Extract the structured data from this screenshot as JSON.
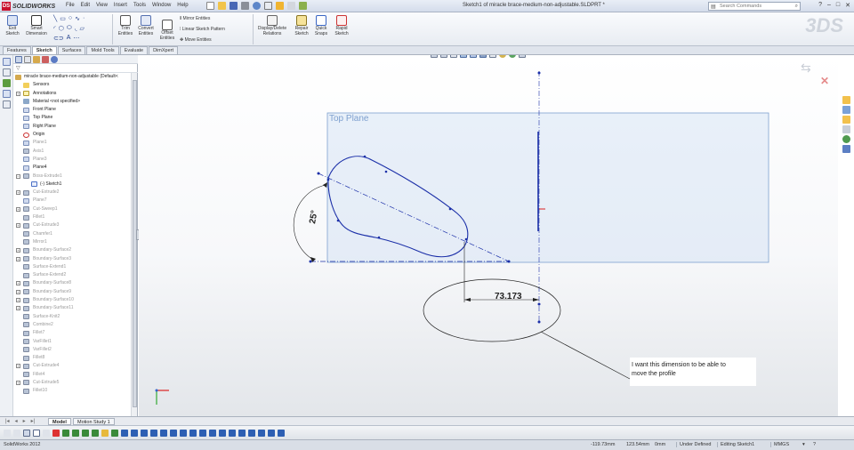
{
  "app": {
    "brand": "SOLIDWORKS",
    "logo_mark": "DS",
    "menus": [
      "File",
      "Edit",
      "View",
      "Insert",
      "Tools",
      "Window",
      "Help"
    ],
    "document_title": "Sketch1 of miracle brace-medium-non-adjustable.SLDPRT *",
    "search_placeholder": "Search Commands",
    "window_controls": [
      "?",
      "–",
      "□",
      "✕"
    ]
  },
  "command_manager": {
    "exit_sketch": "Exit Sketch",
    "smart_dimension": "Smart Dimension",
    "trim_entities": "Trim Entities",
    "convert_entities": "Convert Entities",
    "offset_entities": "Offset Entities",
    "mirror_entities": "Mirror Entities",
    "linear_sketch_pattern": "Linear Sketch Pattern",
    "move_entities": "Move Entities",
    "display_delete_relations": "Display/Delete Relations",
    "repair_sketch": "Repair Sketch",
    "quick_snaps": "Quick Snaps",
    "rapid_sketch": "Rapid Sketch",
    "watermark": "3DS"
  },
  "tabs": [
    "Features",
    "Sketch",
    "Surfaces",
    "Mold Tools",
    "Evaluate",
    "DimXpert"
  ],
  "active_tab": "Sketch",
  "feature_tree": [
    {
      "label": "miracle brace-medium-non-adjustable  (Default<",
      "icon": "part",
      "expand": "",
      "level": "root",
      "gray": false
    },
    {
      "label": "Sensors",
      "icon": "sensor",
      "expand": "",
      "level": "item",
      "gray": false
    },
    {
      "label": "Annotations",
      "icon": "ann",
      "expand": "+",
      "level": "item",
      "gray": false
    },
    {
      "label": "Material <not specified>",
      "icon": "mat",
      "expand": "",
      "level": "item",
      "gray": false
    },
    {
      "label": "Front Plane",
      "icon": "plane",
      "expand": "",
      "level": "item",
      "gray": false
    },
    {
      "label": "Top Plane",
      "icon": "plane",
      "expand": "",
      "level": "item",
      "gray": false
    },
    {
      "label": "Right Plane",
      "icon": "plane",
      "expand": "",
      "level": "item",
      "gray": false
    },
    {
      "label": "Origin",
      "icon": "origin",
      "expand": "",
      "level": "item",
      "gray": false
    },
    {
      "label": "Plane1",
      "icon": "plane",
      "expand": "",
      "level": "item",
      "gray": true
    },
    {
      "label": "Axis1",
      "icon": "feat",
      "expand": "",
      "level": "item",
      "gray": true
    },
    {
      "label": "Plane3",
      "icon": "plane",
      "expand": "",
      "level": "item",
      "gray": true
    },
    {
      "label": "Plane4",
      "icon": "plane",
      "expand": "",
      "level": "item",
      "gray": false
    },
    {
      "label": "Boss-Extrude1",
      "icon": "feat",
      "expand": "−",
      "level": "item",
      "gray": true
    },
    {
      "label": "(-) Sketch1",
      "icon": "sketch",
      "expand": "",
      "level": "sub",
      "gray": false
    },
    {
      "label": "Cut-Extrude2",
      "icon": "feat",
      "expand": "+",
      "level": "item",
      "gray": true
    },
    {
      "label": "Plane7",
      "icon": "plane",
      "expand": "",
      "level": "item",
      "gray": true
    },
    {
      "label": "Cut-Sweep1",
      "icon": "feat",
      "expand": "+",
      "level": "item",
      "gray": true
    },
    {
      "label": "Fillet1",
      "icon": "feat",
      "expand": "",
      "level": "item",
      "gray": true
    },
    {
      "label": "Cut-Extrude3",
      "icon": "feat",
      "expand": "+",
      "level": "item",
      "gray": true
    },
    {
      "label": "Chamfer1",
      "icon": "feat",
      "expand": "",
      "level": "item",
      "gray": true
    },
    {
      "label": "Mirror1",
      "icon": "feat",
      "expand": "",
      "level": "item",
      "gray": true
    },
    {
      "label": "Boundary-Surface2",
      "icon": "feat",
      "expand": "+",
      "level": "item",
      "gray": true
    },
    {
      "label": "Boundary-Surface3",
      "icon": "feat",
      "expand": "+",
      "level": "item",
      "gray": true
    },
    {
      "label": "Surface-Extend1",
      "icon": "feat",
      "expand": "",
      "level": "item",
      "gray": true
    },
    {
      "label": "Surface-Extend2",
      "icon": "feat",
      "expand": "",
      "level": "item",
      "gray": true
    },
    {
      "label": "Boundary-Surface8",
      "icon": "feat",
      "expand": "+",
      "level": "item",
      "gray": true
    },
    {
      "label": "Boundary-Surface9",
      "icon": "feat",
      "expand": "+",
      "level": "item",
      "gray": true
    },
    {
      "label": "Boundary-Surface10",
      "icon": "feat",
      "expand": "+",
      "level": "item",
      "gray": true
    },
    {
      "label": "Boundary-Surface11",
      "icon": "feat",
      "expand": "+",
      "level": "item",
      "gray": true
    },
    {
      "label": "Surface-Knit2",
      "icon": "feat",
      "expand": "",
      "level": "item",
      "gray": true
    },
    {
      "label": "Combine2",
      "icon": "feat",
      "expand": "",
      "level": "item",
      "gray": true
    },
    {
      "label": "Fillet7",
      "icon": "feat",
      "expand": "",
      "level": "item",
      "gray": true
    },
    {
      "label": "VarFillet1",
      "icon": "feat",
      "expand": "",
      "level": "item",
      "gray": true
    },
    {
      "label": "VarFillet2",
      "icon": "feat",
      "expand": "",
      "level": "item",
      "gray": true
    },
    {
      "label": "Fillet8",
      "icon": "feat",
      "expand": "",
      "level": "item",
      "gray": true
    },
    {
      "label": "Cut-Extrude4",
      "icon": "feat",
      "expand": "+",
      "level": "item",
      "gray": true
    },
    {
      "label": "Fillet4",
      "icon": "feat",
      "expand": "",
      "level": "item",
      "gray": true
    },
    {
      "label": "Cut-Extrude5",
      "icon": "feat",
      "expand": "+",
      "level": "item",
      "gray": true
    },
    {
      "label": "Fillet10",
      "icon": "feat",
      "expand": "",
      "level": "item",
      "gray": true
    }
  ],
  "viewport": {
    "plane_label": "Top Plane",
    "angle_dimension": "25°",
    "linear_dimension": "73.173",
    "note_line1": "I want this dimension to be able to",
    "note_line2": "move the profile",
    "sketch_color": "#1b2fa8",
    "plane_color": "#7ea0cf"
  },
  "model_tabs": [
    "Model",
    "Motion Study 1"
  ],
  "status": {
    "app_version": "SolidWorks 2012",
    "x": "-119.73mm",
    "y": "123.54mm",
    "z": "0mm",
    "state": "Under Defined",
    "editing": "Editing Sketch1",
    "units": "MMGS"
  }
}
